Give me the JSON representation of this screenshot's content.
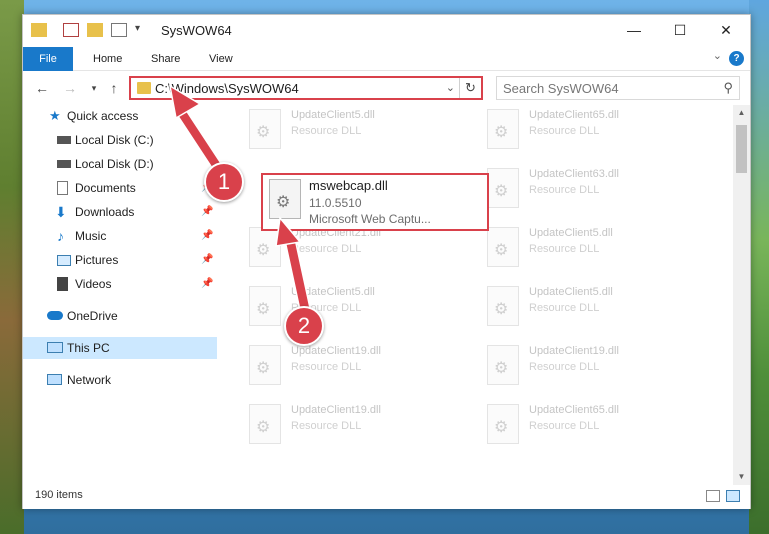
{
  "window": {
    "title": "SysWOW64",
    "controls": {
      "minimize": "—",
      "maximize": "☐",
      "close": "✕"
    }
  },
  "ribbon": {
    "tabs": [
      "File",
      "Home",
      "Share",
      "View"
    ],
    "help_label": "?"
  },
  "navigation": {
    "address": "C:\\Windows\\SysWOW64",
    "search_placeholder": "Search SysWOW64"
  },
  "sidebar": {
    "items": [
      {
        "label": "Quick access"
      },
      {
        "label": "Local Disk (C:)"
      },
      {
        "label": "Local Disk (D:)"
      },
      {
        "label": "Documents"
      },
      {
        "label": "Downloads"
      },
      {
        "label": "Music"
      },
      {
        "label": "Pictures"
      },
      {
        "label": "Videos"
      },
      {
        "label": "OneDrive"
      },
      {
        "label": "This PC"
      },
      {
        "label": "Network"
      }
    ]
  },
  "files": {
    "highlighted": {
      "name": "mswebcap.dll",
      "version": "11.0.5510",
      "description": "Microsoft Web Captu..."
    },
    "tiles": [
      {
        "name": "UpdateClient5.dll",
        "desc": "Resource DLL"
      },
      {
        "name": "UpdateClient65.dll",
        "desc": "Resource DLL"
      },
      {
        "name": "UpdateClient63.dll",
        "desc": "Resource DLL"
      },
      {
        "name": "UpdateClient21.dll",
        "desc": "Resource DLL"
      },
      {
        "name": "UpdateClient5.dll",
        "desc": "Resource DLL"
      },
      {
        "name": "UpdateClient5.dll",
        "desc": "Resource DLL"
      },
      {
        "name": "UpdateClient5.dll",
        "desc": "Resource DLL"
      },
      {
        "name": "UpdateClient19.dll",
        "desc": "Resource DLL"
      },
      {
        "name": "UpdateClient19.dll",
        "desc": "Resource DLL"
      },
      {
        "name": "UpdateClient19.dll",
        "desc": "Resource DLL"
      },
      {
        "name": "UpdateClient65.dll",
        "desc": "Resource DLL"
      }
    ]
  },
  "status": {
    "item_count": "190 items"
  },
  "callouts": {
    "one": "1",
    "two": "2"
  },
  "colors": {
    "accent": "#1979ca",
    "highlight": "#d9414b",
    "selection": "#cce8ff"
  }
}
